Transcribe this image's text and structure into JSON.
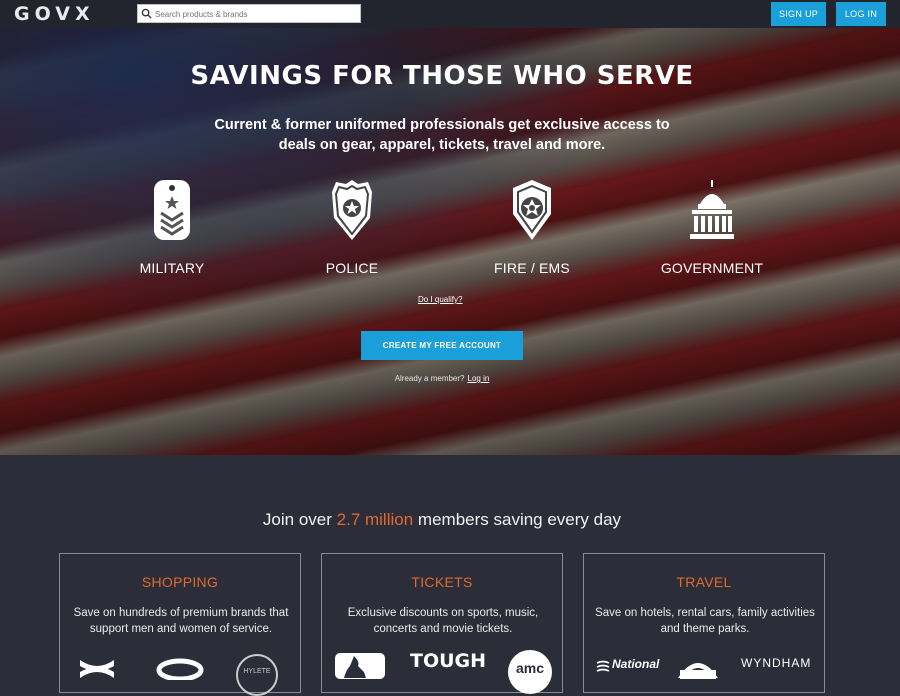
{
  "header": {
    "logo": "GOVX",
    "search_placeholder": "Search products & brands",
    "signup_label": "SIGN UP",
    "login_label": "LOG IN"
  },
  "hero": {
    "title": "SAVINGS FOR THOSE WHO SERVE",
    "subtitle": "Current & former uniformed professionals get exclusive access to deals on gear, apparel, tickets, travel and more.",
    "categories": [
      {
        "label": "MILITARY",
        "icon": "dog-tag-icon"
      },
      {
        "label": "POLICE",
        "icon": "police-badge-icon"
      },
      {
        "label": "FIRE / EMS",
        "icon": "fire-badge-icon"
      },
      {
        "label": "GOVERNMENT",
        "icon": "capitol-building-icon"
      }
    ],
    "qualify_link": "Do I qualify?",
    "cta_label": "CREATE MY FREE ACCOUNT",
    "already_member": "Already a member?",
    "login_link": "Log in"
  },
  "members": {
    "prefix": "Join over",
    "count": "2.7 million",
    "suffix": "members saving every day"
  },
  "cards": [
    {
      "title": "SHOPPING",
      "description": "Save on hundreds of premium brands that support men and women of service.",
      "logos": [
        "under-armour-logo",
        "oakley-logo",
        "hylete-logo"
      ]
    },
    {
      "title": "TICKETS",
      "description": "Exclusive discounts on sports, music, concerts and movie tickets.",
      "logos": [
        "mlb-logo",
        "tough-mudder-logo",
        "amc-logo"
      ]
    },
    {
      "title": "TRAVEL",
      "description": "Save on hotels, rental cars, family activities and theme parks.",
      "logos": [
        "national-logo",
        "six-flags-logo",
        "wyndham-logo"
      ]
    }
  ],
  "logo_text": {
    "hylete": "HYLETE",
    "tough": "TOUGH",
    "amc": "amc",
    "national": "National",
    "wyndham": "WYNDHAM"
  },
  "colors": {
    "accent_blue": "#1a9fd9",
    "accent_orange": "#e06a2f",
    "background": "#2b2d38",
    "topbar": "#23252e"
  }
}
